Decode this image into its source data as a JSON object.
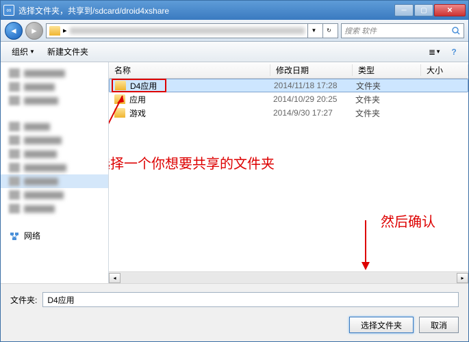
{
  "title": "选择文件夹，共享到/sdcard/droid4xshare",
  "search": {
    "placeholder": "搜索 软件"
  },
  "toolbar": {
    "organize": "组织",
    "newFolder": "新建文件夹"
  },
  "columns": {
    "name": "名称",
    "date": "修改日期",
    "type": "类型",
    "size": "大小"
  },
  "files": [
    {
      "name": "D4应用",
      "date": "2014/11/18 17:28",
      "type": "文件夹",
      "selected": true
    },
    {
      "name": "应用",
      "date": "2014/10/29 20:25",
      "type": "文件夹",
      "selected": false
    },
    {
      "name": "游戏",
      "date": "2014/9/30 17:27",
      "type": "文件夹",
      "selected": false
    }
  ],
  "sidebar": {
    "network": "网络"
  },
  "footer": {
    "folderLabel": "文件夹:",
    "folderValue": "D4应用",
    "selectBtn": "选择文件夹",
    "cancelBtn": "取消"
  },
  "annotations": {
    "text1": "选择一个你想要共享的文件夹",
    "text2": "然后确认"
  }
}
